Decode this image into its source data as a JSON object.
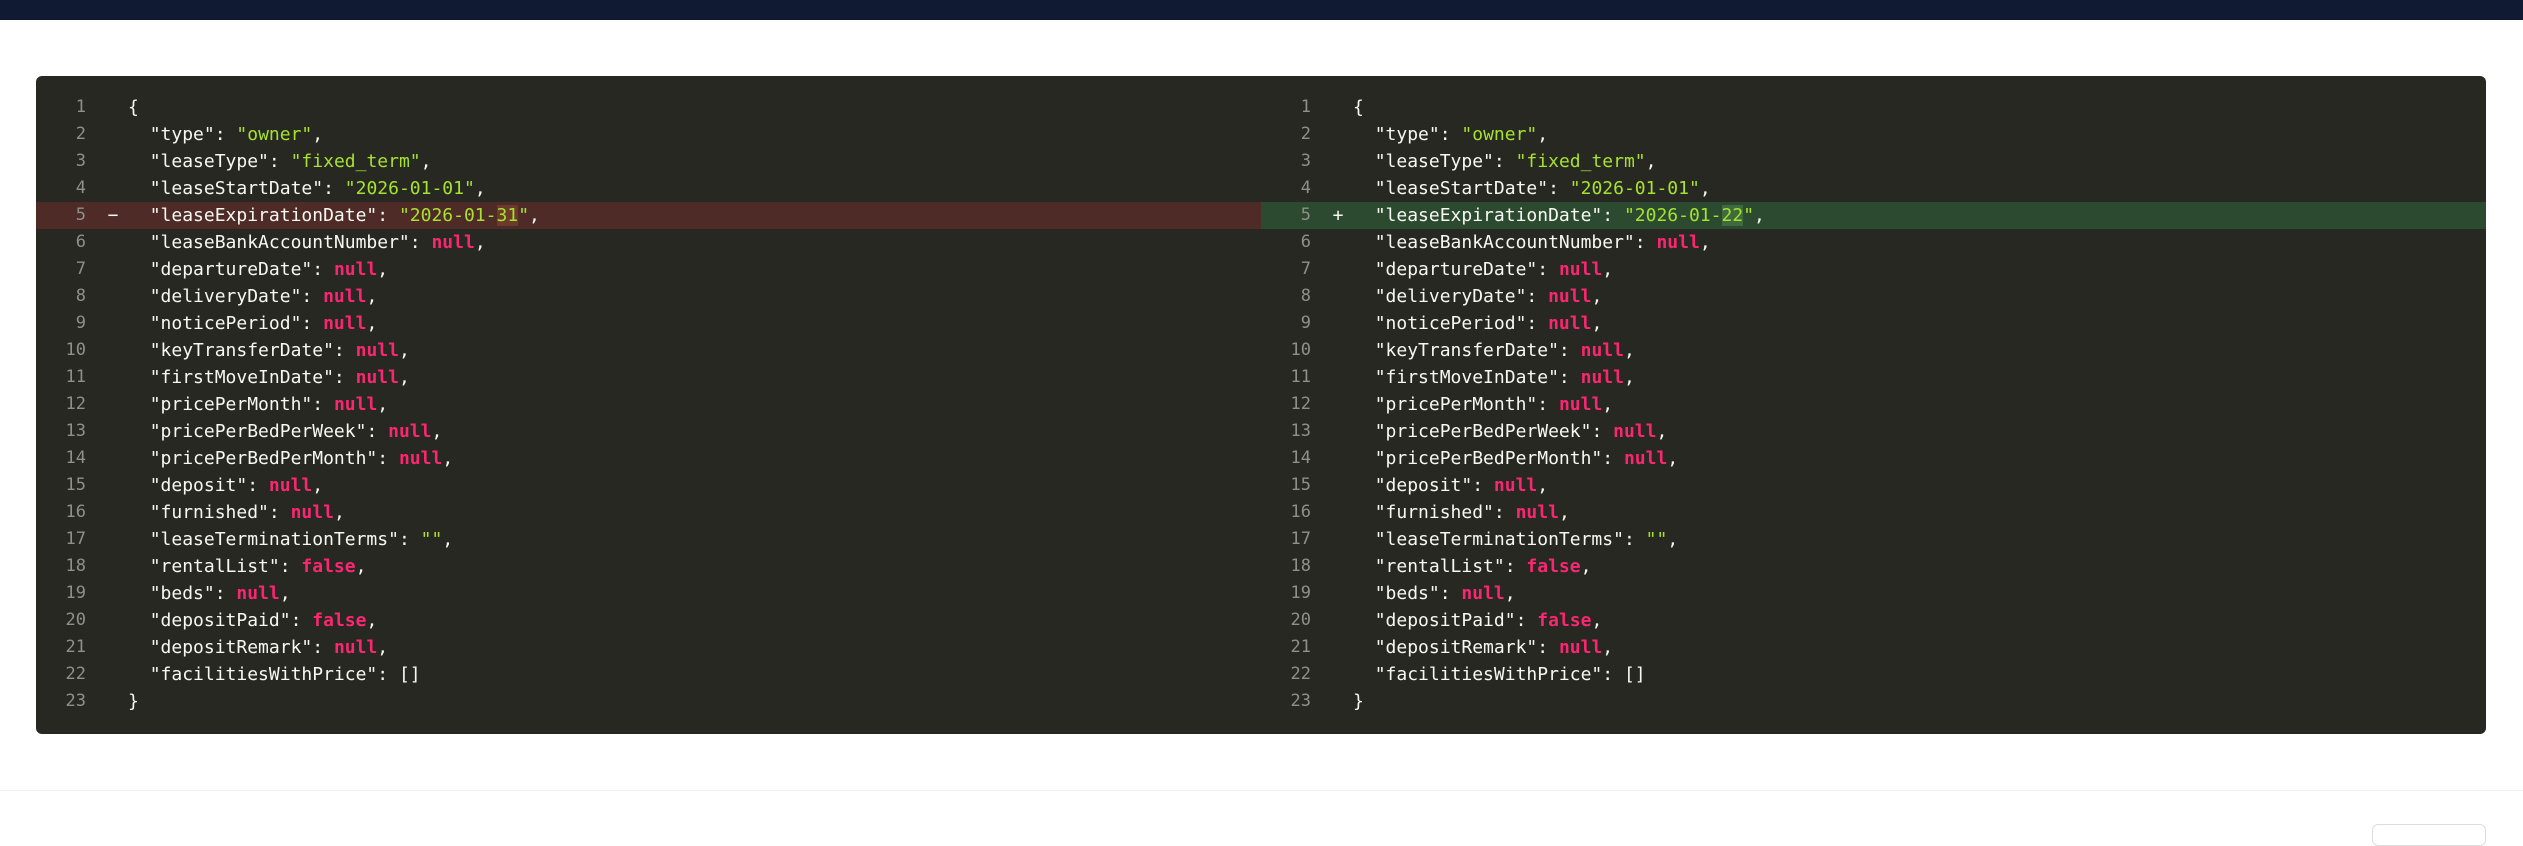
{
  "diff": {
    "left": {
      "lines": [
        {
          "n": "1",
          "m": "",
          "t": "{",
          "type": "punc"
        },
        {
          "n": "2",
          "m": "",
          "k": "\"type\"",
          "v": "\"owner\"",
          "vt": "str"
        },
        {
          "n": "3",
          "m": "",
          "k": "\"leaseType\"",
          "v": "\"fixed_term\"",
          "vt": "str"
        },
        {
          "n": "4",
          "m": "",
          "k": "\"leaseStartDate\"",
          "v": "\"2026-01-01\"",
          "vt": "str"
        },
        {
          "n": "5",
          "m": "−",
          "k": "\"leaseExpirationDate\"",
          "v": "\"2026-01-31\"",
          "vt": "str",
          "state": "removed",
          "vpre": "\"2026-01-",
          "vdiff": "31",
          "vpost": "\""
        },
        {
          "n": "6",
          "m": "",
          "k": "\"leaseBankAccountNumber\"",
          "v": "null",
          "vt": "kw"
        },
        {
          "n": "7",
          "m": "",
          "k": "\"departureDate\"",
          "v": "null",
          "vt": "kw"
        },
        {
          "n": "8",
          "m": "",
          "k": "\"deliveryDate\"",
          "v": "null",
          "vt": "kw"
        },
        {
          "n": "9",
          "m": "",
          "k": "\"noticePeriod\"",
          "v": "null",
          "vt": "kw"
        },
        {
          "n": "10",
          "m": "",
          "k": "\"keyTransferDate\"",
          "v": "null",
          "vt": "kw"
        },
        {
          "n": "11",
          "m": "",
          "k": "\"firstMoveInDate\"",
          "v": "null",
          "vt": "kw"
        },
        {
          "n": "12",
          "m": "",
          "k": "\"pricePerMonth\"",
          "v": "null",
          "vt": "kw"
        },
        {
          "n": "13",
          "m": "",
          "k": "\"pricePerBedPerWeek\"",
          "v": "null",
          "vt": "kw"
        },
        {
          "n": "14",
          "m": "",
          "k": "\"pricePerBedPerMonth\"",
          "v": "null",
          "vt": "kw"
        },
        {
          "n": "15",
          "m": "",
          "k": "\"deposit\"",
          "v": "null",
          "vt": "kw"
        },
        {
          "n": "16",
          "m": "",
          "k": "\"furnished\"",
          "v": "null",
          "vt": "kw"
        },
        {
          "n": "17",
          "m": "",
          "k": "\"leaseTerminationTerms\"",
          "v": "\"\"",
          "vt": "str"
        },
        {
          "n": "18",
          "m": "",
          "k": "\"rentalList\"",
          "v": "false",
          "vt": "kw"
        },
        {
          "n": "19",
          "m": "",
          "k": "\"beds\"",
          "v": "null",
          "vt": "kw"
        },
        {
          "n": "20",
          "m": "",
          "k": "\"depositPaid\"",
          "v": "false",
          "vt": "kw"
        },
        {
          "n": "21",
          "m": "",
          "k": "\"depositRemark\"",
          "v": "null",
          "vt": "kw"
        },
        {
          "n": "22",
          "m": "",
          "k": "\"facilitiesWithPrice\"",
          "v": "[]",
          "vt": "punc",
          "last": true
        },
        {
          "n": "23",
          "m": "",
          "t": "}",
          "type": "punc"
        }
      ]
    },
    "right": {
      "lines": [
        {
          "n": "1",
          "m": "",
          "t": "{",
          "type": "punc"
        },
        {
          "n": "2",
          "m": "",
          "k": "\"type\"",
          "v": "\"owner\"",
          "vt": "str"
        },
        {
          "n": "3",
          "m": "",
          "k": "\"leaseType\"",
          "v": "\"fixed_term\"",
          "vt": "str"
        },
        {
          "n": "4",
          "m": "",
          "k": "\"leaseStartDate\"",
          "v": "\"2026-01-01\"",
          "vt": "str"
        },
        {
          "n": "5",
          "m": "+",
          "k": "\"leaseExpirationDate\"",
          "v": "\"2026-01-22\"",
          "vt": "str",
          "state": "added",
          "vpre": "\"2026-01-",
          "vdiff": "22",
          "vpost": "\""
        },
        {
          "n": "6",
          "m": "",
          "k": "\"leaseBankAccountNumber\"",
          "v": "null",
          "vt": "kw"
        },
        {
          "n": "7",
          "m": "",
          "k": "\"departureDate\"",
          "v": "null",
          "vt": "kw"
        },
        {
          "n": "8",
          "m": "",
          "k": "\"deliveryDate\"",
          "v": "null",
          "vt": "kw"
        },
        {
          "n": "9",
          "m": "",
          "k": "\"noticePeriod\"",
          "v": "null",
          "vt": "kw"
        },
        {
          "n": "10",
          "m": "",
          "k": "\"keyTransferDate\"",
          "v": "null",
          "vt": "kw"
        },
        {
          "n": "11",
          "m": "",
          "k": "\"firstMoveInDate\"",
          "v": "null",
          "vt": "kw"
        },
        {
          "n": "12",
          "m": "",
          "k": "\"pricePerMonth\"",
          "v": "null",
          "vt": "kw"
        },
        {
          "n": "13",
          "m": "",
          "k": "\"pricePerBedPerWeek\"",
          "v": "null",
          "vt": "kw"
        },
        {
          "n": "14",
          "m": "",
          "k": "\"pricePerBedPerMonth\"",
          "v": "null",
          "vt": "kw"
        },
        {
          "n": "15",
          "m": "",
          "k": "\"deposit\"",
          "v": "null",
          "vt": "kw"
        },
        {
          "n": "16",
          "m": "",
          "k": "\"furnished\"",
          "v": "null",
          "vt": "kw"
        },
        {
          "n": "17",
          "m": "",
          "k": "\"leaseTerminationTerms\"",
          "v": "\"\"",
          "vt": "str"
        },
        {
          "n": "18",
          "m": "",
          "k": "\"rentalList\"",
          "v": "false",
          "vt": "kw"
        },
        {
          "n": "19",
          "m": "",
          "k": "\"beds\"",
          "v": "null",
          "vt": "kw"
        },
        {
          "n": "20",
          "m": "",
          "k": "\"depositPaid\"",
          "v": "false",
          "vt": "kw"
        },
        {
          "n": "21",
          "m": "",
          "k": "\"depositRemark\"",
          "v": "null",
          "vt": "kw"
        },
        {
          "n": "22",
          "m": "",
          "k": "\"facilitiesWithPrice\"",
          "v": "[]",
          "vt": "punc",
          "last": true
        },
        {
          "n": "23",
          "m": "",
          "t": "}",
          "type": "punc"
        }
      ]
    }
  },
  "colors": {
    "background": "#272822",
    "removed_line": "#4e2b27",
    "added_line": "#2c4a30",
    "string": "#a6e22e",
    "keyword": "#f92672"
  }
}
